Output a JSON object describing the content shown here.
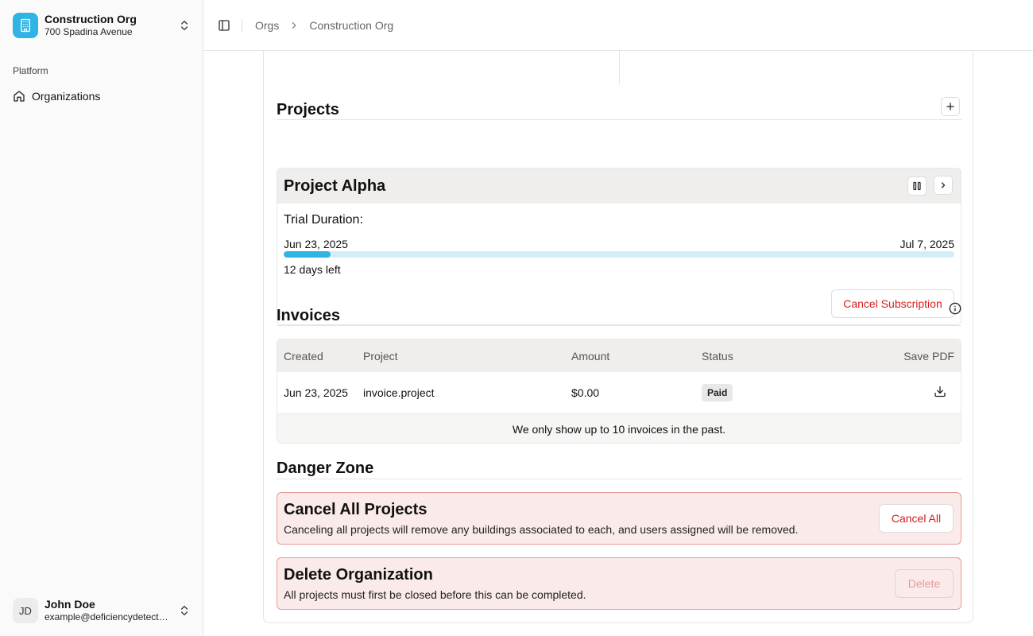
{
  "sidebar": {
    "org": {
      "name": "Construction Org",
      "address": "700 Spadina Avenue",
      "icon": "building-icon"
    },
    "group_label": "Platform",
    "nav": [
      {
        "label": "Organizations",
        "icon": "home-icon"
      }
    ],
    "user": {
      "initials": "JD",
      "name": "John Doe",
      "email": "example@deficiencydetect...."
    }
  },
  "header": {
    "breadcrumbs": [
      "Orgs",
      "Construction Org"
    ]
  },
  "projects": {
    "title": "Projects",
    "items": [
      {
        "name": "Project Alpha",
        "trial_label": "Trial Duration:",
        "start_date": "Jun 23, 2025",
        "end_date": "Jul 7, 2025",
        "progress": 0.07,
        "days_left": "12 days left",
        "cancel_label": "Cancel Subscription"
      }
    ]
  },
  "invoices": {
    "title": "Invoices",
    "columns": [
      "Created",
      "Project",
      "Amount",
      "Status",
      "Save PDF"
    ],
    "rows": [
      {
        "created": "Jun 23, 2025",
        "project": "invoice.project",
        "amount": "$0.00",
        "status": "Paid"
      }
    ],
    "footer_note": "We only show up to 10 invoices in the past."
  },
  "danger": {
    "title": "Danger Zone",
    "cancel_all": {
      "title": "Cancel All Projects",
      "description": "Canceling all projects will remove any buildings associated to each, and users assigned will be removed.",
      "button": "Cancel All"
    },
    "delete_org": {
      "title": "Delete Organization",
      "description": "All projects must first be closed before this can be completed.",
      "button": "Delete"
    }
  },
  "colors": {
    "accent": "#2fb4e4",
    "danger": "#d42020",
    "danger_bg": "#fbeaea",
    "danger_border": "#e89a9a"
  }
}
